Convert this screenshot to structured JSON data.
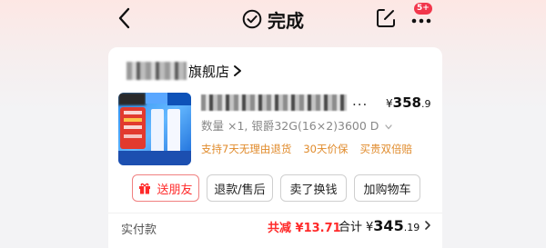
{
  "header": {
    "back_icon": "chevron-left-icon",
    "title": "完成",
    "title_icon": "check-circle-icon",
    "share_icon": "share-edit-icon",
    "more_icon": "more-dots-icon",
    "more_badge": "5+"
  },
  "order": {
    "store_name_suffix": "旗舰店",
    "product": {
      "ellipsis": "...",
      "price_symbol": "¥",
      "price_int": "358",
      "price_dec": ".9",
      "spec": "数量 ×1, 银爵32G(16×2)3600 D",
      "services": [
        "支持7天无理由退货",
        "30天价保",
        "买贵双倍赔"
      ]
    },
    "actions": {
      "gift": "送朋友",
      "refund": "退款/售后",
      "resell": "卖了换钱",
      "add_cart": "加购物车"
    },
    "summary": {
      "paid_label": "实付款",
      "savings": "共减 ¥13.71",
      "total_label": "合计",
      "total_symbol": "¥",
      "total_int": "345",
      "total_dec": ".19"
    }
  },
  "colors": {
    "accent": "#ff2a2a",
    "badge": "#f2364b",
    "service": "#e08a2a"
  }
}
